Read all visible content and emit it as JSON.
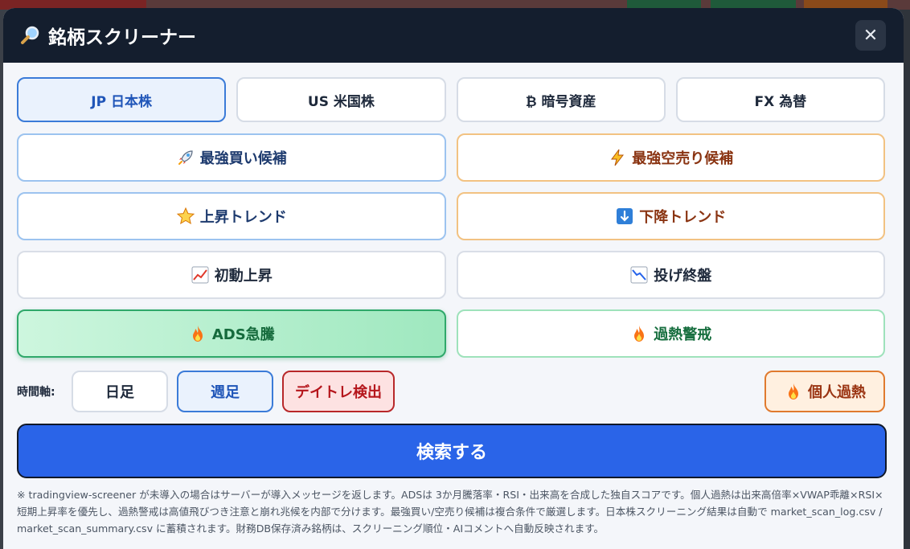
{
  "modal": {
    "title": "銘柄スクリーナー",
    "close_label": "✕"
  },
  "markets": [
    {
      "label": "JP 日本株",
      "active": true
    },
    {
      "label": "US 米国株",
      "active": false
    },
    {
      "label": "₿ 暗号資産",
      "active": false
    },
    {
      "label": "FX 為替",
      "active": false
    }
  ],
  "strategies": {
    "strong_buy": {
      "icon": "rocket-icon",
      "label": "最強買い候補"
    },
    "strong_short": {
      "icon": "lightning-icon",
      "label": "最強空売り候補"
    },
    "uptrend": {
      "icon": "star-icon",
      "label": "上昇トレンド"
    },
    "downtrend": {
      "icon": "down-arrow-icon",
      "label": "下降トレンド"
    },
    "initial_rise": {
      "icon": "chart-up-icon",
      "label": "初動上昇"
    },
    "capitulation": {
      "icon": "chart-down-icon",
      "label": "投げ終盤"
    },
    "ads_surge": {
      "icon": "fire-icon",
      "label": "ADS急騰"
    },
    "overheat_alert": {
      "icon": "fire-icon",
      "label": "過熱警戒"
    }
  },
  "timeframe": {
    "label": "時間軸:",
    "daily": "日足",
    "weekly": "週足",
    "daytrade": "デイトレ検出",
    "personal_overheat": "個人過熱"
  },
  "search_label": "検索する",
  "note": "※ tradingview-screener が未導入の場合はサーバーが導入メッセージを返します。ADSは 3か月騰落率・RSI・出来高を合成した独自スコアです。個人過熱は出来高倍率×VWAP乖離×RSI×短期上昇率を優先し、過熱警戒は高値飛びつき注意と崩れ兆候を内部で分けます。最強買い/空売り候補は複合条件で厳選します。日本株スクリーニング結果は自動で market_scan_log.csv / market_scan_summary.csv に蓄積されます。財務DB保存済み銘柄は、スクリーニング順位・AIコメントへ自動反映されます。",
  "colors": {
    "header_bg": "#141e2e",
    "accent_blue": "#2a64e8",
    "active_tab": "#3b7bd8",
    "daytrade_red": "#b8282a",
    "personal_orange": "#e07a2e",
    "ads_green": "#2fa86a"
  }
}
